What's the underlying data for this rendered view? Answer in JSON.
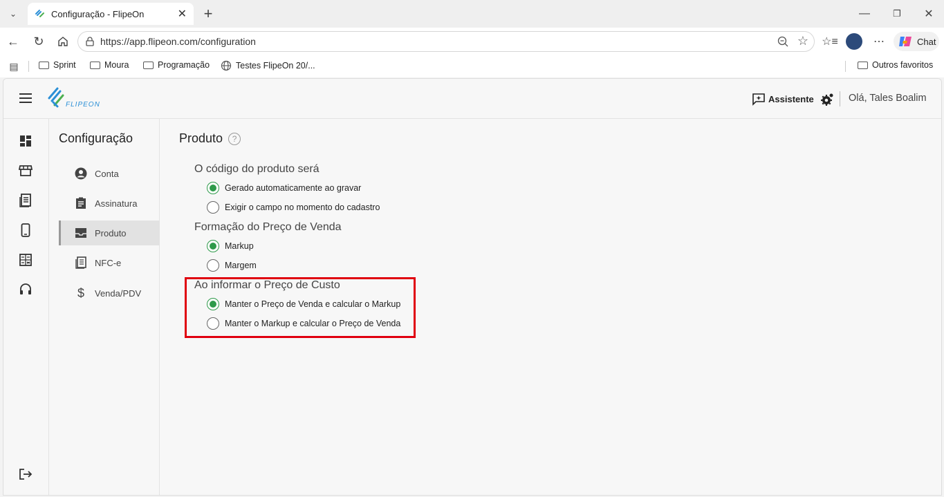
{
  "browser": {
    "tab_title": "Configuração - FlipeOn",
    "url": "https://app.flipeon.com/configuration",
    "chat_label": "Chat",
    "bookmarks": [
      "Sprint",
      "Moura",
      "Programação",
      "Testes FlipeOn 20/..."
    ],
    "other_bookmarks": "Outros favoritos"
  },
  "app": {
    "logo_text": "FLIPEON",
    "assistant_label": "Assistente",
    "greeting": "Olá, Tales Boalim",
    "rail_icons": [
      "dashboard-icon",
      "store-icon",
      "receipt-icon",
      "mobile-icon",
      "calculator-icon",
      "headset-icon",
      "logout-icon"
    ]
  },
  "config_nav": {
    "title": "Configuração",
    "items": [
      {
        "label": "Conta",
        "icon": "account-icon"
      },
      {
        "label": "Assinatura",
        "icon": "clipboard-icon"
      },
      {
        "label": "Produto",
        "icon": "inbox-icon"
      },
      {
        "label": "NFC-e",
        "icon": "receipt-icon"
      },
      {
        "label": "Venda/PDV",
        "icon": "dollar-icon"
      }
    ],
    "active": "Produto"
  },
  "content": {
    "title": "Produto",
    "groups": [
      {
        "title": "O código do produto será",
        "options": [
          {
            "label": "Gerado automaticamente ao gravar",
            "checked": true
          },
          {
            "label": "Exigir o campo no momento do cadastro",
            "checked": false
          }
        ]
      },
      {
        "title": "Formação do Preço de Venda",
        "options": [
          {
            "label": "Markup",
            "checked": true
          },
          {
            "label": "Margem",
            "checked": false
          }
        ]
      },
      {
        "title": "Ao informar o Preço de Custo",
        "highlighted": true,
        "options": [
          {
            "label": "Manter o Preço de Venda e calcular o Markup",
            "checked": true
          },
          {
            "label": "Manter o Markup e calcular o Preço de Venda",
            "checked": false
          }
        ]
      }
    ]
  },
  "colors": {
    "accent_green": "#2e9a4a",
    "highlight_red": "#e0000f",
    "logo_blue": "#2b8fd6",
    "logo_green": "#4caf50"
  }
}
